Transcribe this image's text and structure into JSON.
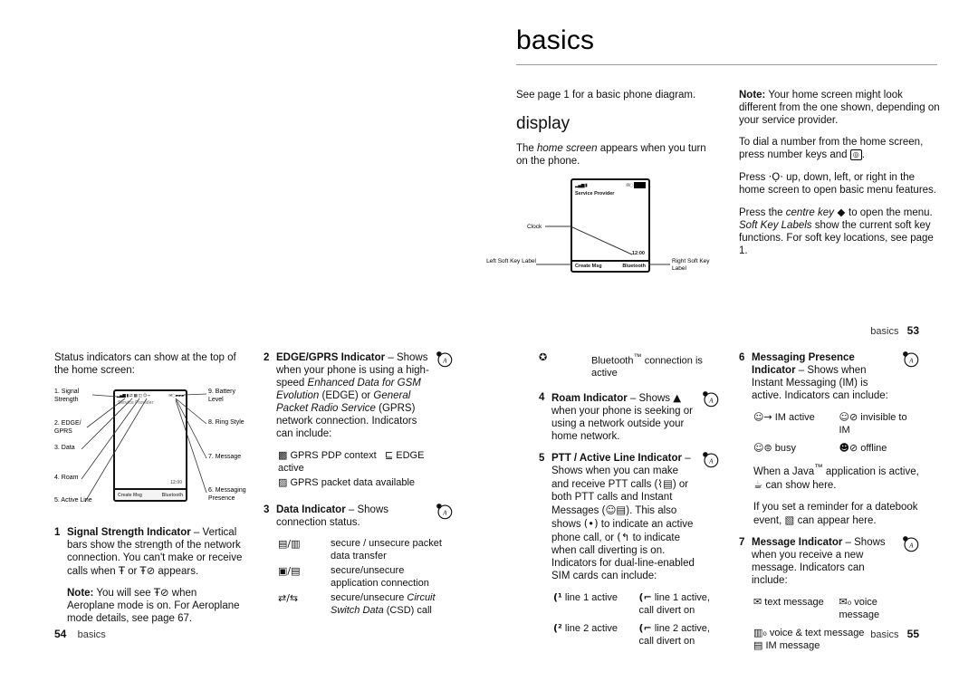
{
  "document": {
    "chapter_title": "basics"
  },
  "page53": {
    "intro": "See page 1 for a basic phone diagram.",
    "display_heading": "display",
    "home_screen_text_pre": "The ",
    "home_screen_italic": "home screen",
    "home_screen_text_post": " appears when you turn on the phone.",
    "diagram": {
      "provider_label": "Service Provider",
      "clock_value": "12:00",
      "left_soft_key_label": "Create Msg",
      "right_soft_key_label": "Bluetooth",
      "callout_clock": "Clock",
      "callout_left_soft": "Left Soft Key Label",
      "callout_right_soft": "Right Soft Key Label"
    },
    "note_label": "Note:",
    "note_text": " Your home screen might look different from the one shown, depending on your service provider.",
    "dial_text_pre": "To dial a number from the home screen, press number keys and ",
    "dial_key_glyph": "◎",
    "dial_text_post": ".",
    "press_nav_pre": "Press ",
    "press_nav_glyph": "·Ọ·",
    "press_nav_post": " up, down, left, or right in the home screen to open basic menu features.",
    "centre_pre": "Press the ",
    "centre_italic": "centre key",
    "centre_glyph": " ◆ ",
    "centre_post": "to open the menu. ",
    "softkey_italic": "Soft Key Labels",
    "softkey_post": " show the current soft key functions. For soft key locations, see page 1.",
    "footer_name": "basics",
    "footer_page": "53"
  },
  "page54": {
    "lead": "Status indicators can show at the top of the home screen:",
    "callouts_left": [
      {
        "num": "1.",
        "label": "Signal Strength"
      },
      {
        "num": "2.",
        "label": "EDGE/ GPRS"
      },
      {
        "num": "3.",
        "label": "Data"
      },
      {
        "num": "4.",
        "label": "Roam"
      },
      {
        "num": "5.",
        "label": "Active Line"
      }
    ],
    "callouts_right": [
      {
        "num": "9.",
        "label": "Battery Level"
      },
      {
        "num": "8.",
        "label": "Ring Style"
      },
      {
        "num": "7.",
        "label": "Message"
      },
      {
        "num": "6.",
        "label": "Messaging Presence"
      }
    ],
    "diagram": {
      "provider_label": "Service Provider",
      "clock_value": "12:00",
      "left_soft_key_label": "Create Msg",
      "right_soft_key_label": "Bluetooth"
    },
    "item1": {
      "num": "1",
      "title": "Signal Strength Indicator",
      "dash": " – ",
      "body": "Vertical bars show the strength of the network connection. You can't make or receive calls when ",
      "glyph_a": "Ŧ",
      "mid": " or ",
      "glyph_b": "Ŧ⊘",
      "body_end": " appears.",
      "note_label": "Note:",
      "note_pre": " You will see ",
      "note_glyph": "Ŧ⊘",
      "note_post": " when Aeroplane mode is on. For Aeroplane mode details, see page 67."
    },
    "item2": {
      "num": "2",
      "title": "EDGE/GPRS Indicator",
      "dash": " – ",
      "body_pre": "Shows when your phone is using a high-speed ",
      "it1": "Enhanced Data for GSM Evolution",
      "mid1": " (EDGE) or ",
      "it2": "General Packet Radio Service",
      "mid2": " (GPRS) network connection. Indicators can include:",
      "icons": [
        {
          "glyph": "▩",
          "text": "GPRS PDP context active"
        },
        {
          "glyph": "▨",
          "text": "GPRS packet data available"
        }
      ],
      "icon_right": {
        "glyph": "⊑",
        "text": "EDGE"
      }
    },
    "item3": {
      "num": "3",
      "title": "Data Indicator",
      "dash": " – ",
      "body": "Shows connection status.",
      "rows": [
        {
          "glyph": "▤/▥",
          "text": "secure / unsecure packet data transfer"
        },
        {
          "glyph": "▣/▤",
          "text": "secure/unsecure application connection"
        },
        {
          "glyph": "⇄/⇆",
          "text_pre": "secure/unsecure ",
          "text_it": "Circuit Switch Data",
          "text_post": " (CSD) call"
        }
      ]
    },
    "footer_name": "basics",
    "footer_page": "54"
  },
  "page55": {
    "bluetooth_row": {
      "glyph": "✪",
      "text_pre": "Bluetooth",
      "tm": "™",
      "text_post": " connection is active"
    },
    "item4": {
      "num": "4",
      "title": "Roam Indicator",
      "dash": " – ",
      "body_pre": "Shows ",
      "glyph": "▲",
      "body_post": " when your phone is seeking or using a network outside your home network."
    },
    "item5": {
      "num": "5",
      "title": "PTT / Active Line Indicator",
      "dash": " – ",
      "body_pre": "Shows when you can make and receive PTT calls (",
      "g1": "⌇▤",
      "mid1": ") or both PTT calls and Instant Messages (",
      "g2": "☺▤",
      "mid2": "). This also shows ",
      "g3": "(•)",
      "mid3": " to indicate an active phone call, or ",
      "g4": "(↰",
      "mid4": " to indicate when call diverting is on. Indicators for dual-line-enabled SIM cards can include:",
      "lines": [
        {
          "glyph": "(¹",
          "text": "line 1 active"
        },
        {
          "glyph": "(⌐",
          "text": "line 1 active, call divert on"
        },
        {
          "glyph": "(²",
          "text": "line 2 active"
        },
        {
          "glyph": "(⌐",
          "text": "line 2 active, call divert on"
        }
      ]
    },
    "item6": {
      "num": "6",
      "title": "Messaging Presence Indicator",
      "dash": " – ",
      "body": "Shows when Instant Messaging (IM) is active. Indicators can include:",
      "states": [
        {
          "glyph": "☺→",
          "text": "IM active"
        },
        {
          "glyph": "☺⊘",
          "text": "invisible to IM"
        },
        {
          "glyph": "☺⊜",
          "text": "busy"
        },
        {
          "glyph": "☻⊘",
          "text": "offline"
        }
      ],
      "java_pre": "When a Java",
      "java_tm": "™",
      "java_mid": " application is active, ",
      "java_glyph": "☕",
      "java_post": " can show here.",
      "datebook_pre": "If you set a reminder for a datebook event, ",
      "datebook_glyph": "▧",
      "datebook_post": " can appear here."
    },
    "item7": {
      "num": "7",
      "title": "Message Indicator",
      "dash": " – ",
      "body": "Shows when you receive a new message. Indicators can include:",
      "messages": [
        {
          "glyph": "✉",
          "text": "text message"
        },
        {
          "glyph": "✉₀",
          "text": "voice message"
        },
        {
          "glyph": "▥₀",
          "text": "voice & text message"
        },
        {
          "glyph": "▤",
          "text": "IM message"
        }
      ]
    },
    "footer_name": "basics",
    "footer_page": "55"
  }
}
